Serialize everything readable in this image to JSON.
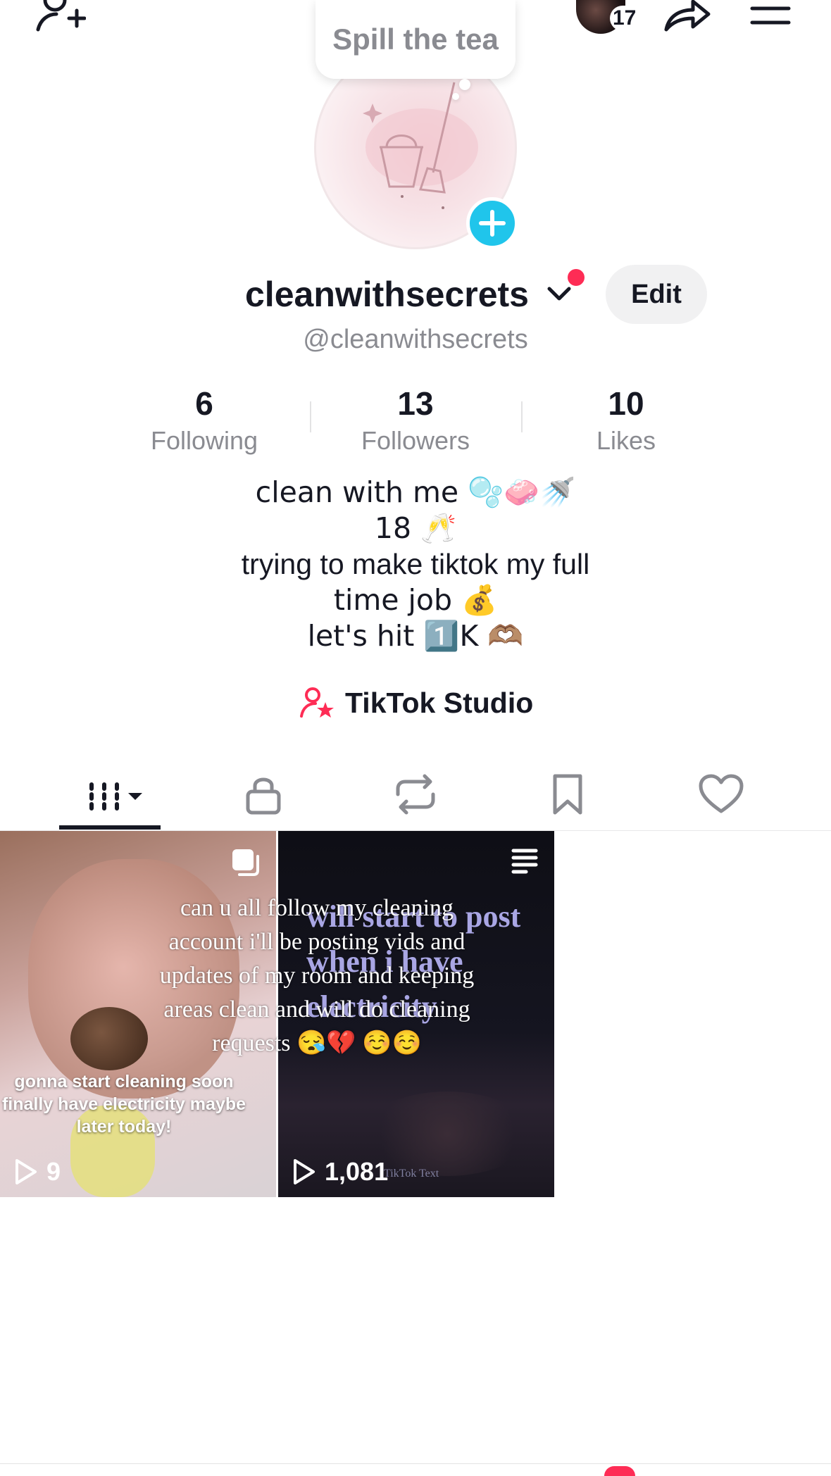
{
  "header": {
    "add_friend_icon": "add-user-icon",
    "story_count": "17",
    "share_icon": "share-icon",
    "menu_icon": "hamburger-menu-icon"
  },
  "profile": {
    "bubble_text": "Spill the tea",
    "display_name": "cleanwithsecrets",
    "handle": "@cleanwithsecrets",
    "edit_label": "Edit"
  },
  "stats": [
    {
      "value": "6",
      "label": "Following"
    },
    {
      "value": "13",
      "label": "Followers"
    },
    {
      "value": "10",
      "label": "Likes"
    }
  ],
  "bio": [
    "clean with me 🫧🧼🚿",
    "18 🥂",
    "trying to make tiktok my full",
    "time job 💰",
    "let's hit 1️⃣K 🫶🏽"
  ],
  "studio": {
    "label": "TikTok Studio"
  },
  "tabs": [
    {
      "name": "videos",
      "icon": "grid-icon",
      "active": true
    },
    {
      "name": "private",
      "icon": "lock-icon",
      "active": false
    },
    {
      "name": "reposts",
      "icon": "repost-icon",
      "active": false
    },
    {
      "name": "saved",
      "icon": "bookmark-icon",
      "active": false
    },
    {
      "name": "liked",
      "icon": "heart-icon",
      "active": false
    }
  ],
  "videos": [
    {
      "caption": "gonna start cleaning soon finally have electricity maybe later today!",
      "plays": "9",
      "corner_icon": "photo-stack-icon"
    },
    {
      "title": "will start to post when i have electricity",
      "plays": "1,081",
      "watermark": "TikTok Text",
      "corner_icon": "text-post-icon"
    }
  ],
  "overlay_caption": "can u all follow my cleaning account i'll be posting vids and updates of my room and keeping areas clean and will do cleaning requests 😪💔 ☺️☺️",
  "colors": {
    "accent_pink": "#fe2c55",
    "plus_blue": "#20c5eb",
    "secondary_text": "#8a8b91"
  }
}
